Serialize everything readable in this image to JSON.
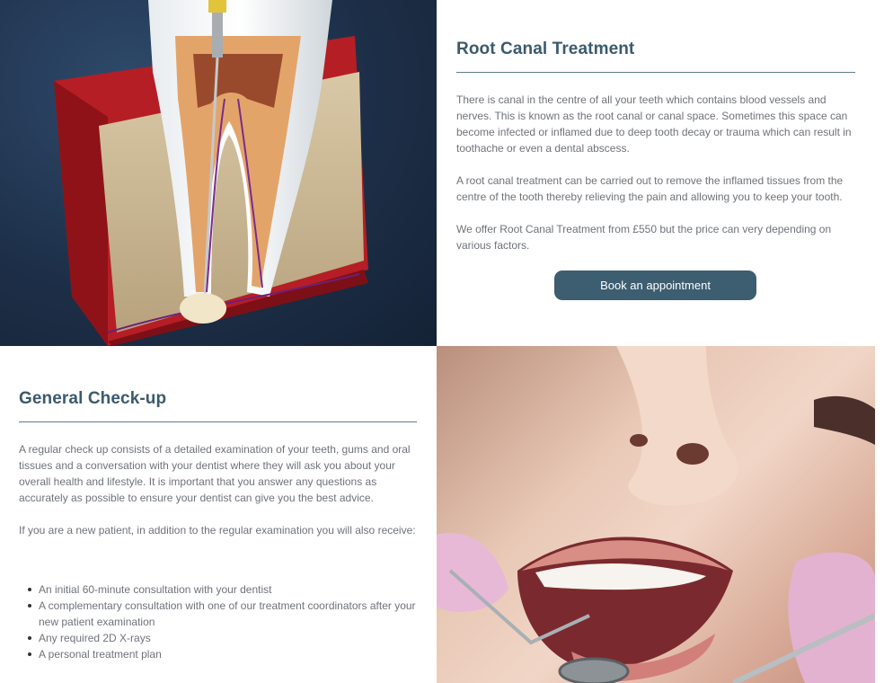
{
  "root_canal": {
    "title": "Root Canal Treatment",
    "paragraphs": [
      "There is canal in the centre of all your teeth which contains blood vessels and nerves. This is known as the root canal or canal space. Sometimes this space can become infected or inflamed due to deep tooth decay or trauma which can result in toothache or even a dental abscess.",
      "A root canal treatment can be carried out to remove the inflamed tissues from the centre of the tooth thereby relieving the pain and allowing you to keep your tooth.",
      "We offer Root Canal Treatment from £550 but the price can very depending on various factors."
    ],
    "button_label": "Book an appointment"
  },
  "checkup": {
    "title": "General Check-up",
    "paragraphs": [
      "A regular check up consists of a detailed examination of your teeth, gums and oral tissues and a conversation with your dentist where they will ask you about your overall health and lifestyle. It is important that you answer any questions as accurately as possible to ensure your dentist can give you the best advice.",
      "If you are a new patient, in addition to the regular examination you will also receive:"
    ],
    "list": [
      "An initial 60-minute consultation with your dentist",
      "A complementary consultation with one of our treatment coordinators after your new patient examination",
      "Any required 2D X-rays",
      "A personal treatment plan"
    ]
  }
}
